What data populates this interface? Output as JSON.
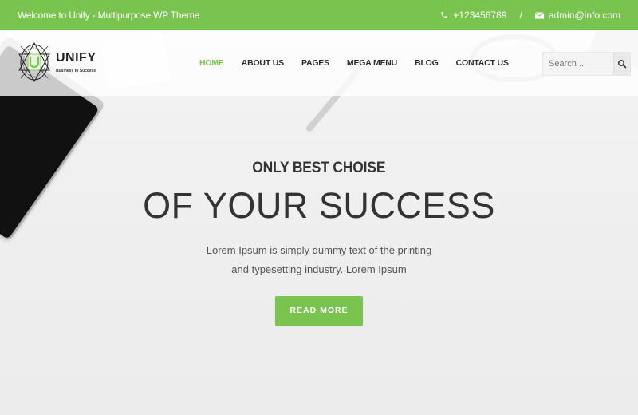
{
  "colors": {
    "accent": "#79c44f",
    "text_dark": "#333333",
    "background": "#efefef"
  },
  "topbar": {
    "welcome": "Welcome to Unify - Multipurpose WP Theme",
    "phone_icon": "phone-icon",
    "phone": "+123456789",
    "separator": "/",
    "email_icon": "envelope-icon",
    "email": "admin@info.com"
  },
  "header": {
    "logo": {
      "title": "UNIFY",
      "tagline": "Business to Success",
      "mark_letter": "U"
    },
    "nav": [
      {
        "label": "HOME",
        "active": true
      },
      {
        "label": "ABOUT US",
        "active": false
      },
      {
        "label": "PAGES",
        "active": false
      },
      {
        "label": "MEGA MENU",
        "active": false
      },
      {
        "label": "BLOG",
        "active": false
      },
      {
        "label": "CONTACT US",
        "active": false
      }
    ],
    "search": {
      "placeholder": "Search ...",
      "value": "",
      "icon": "search-icon"
    }
  },
  "hero": {
    "subtitle": "ONLY BEST CHOISE",
    "title": "OF YOUR SUCCESS",
    "description_line1": "Lorem Ipsum is simply dummy text of the printing",
    "description_line2": "and typesetting industry. Lorem Ipsum",
    "cta_label": "READ MORE"
  }
}
